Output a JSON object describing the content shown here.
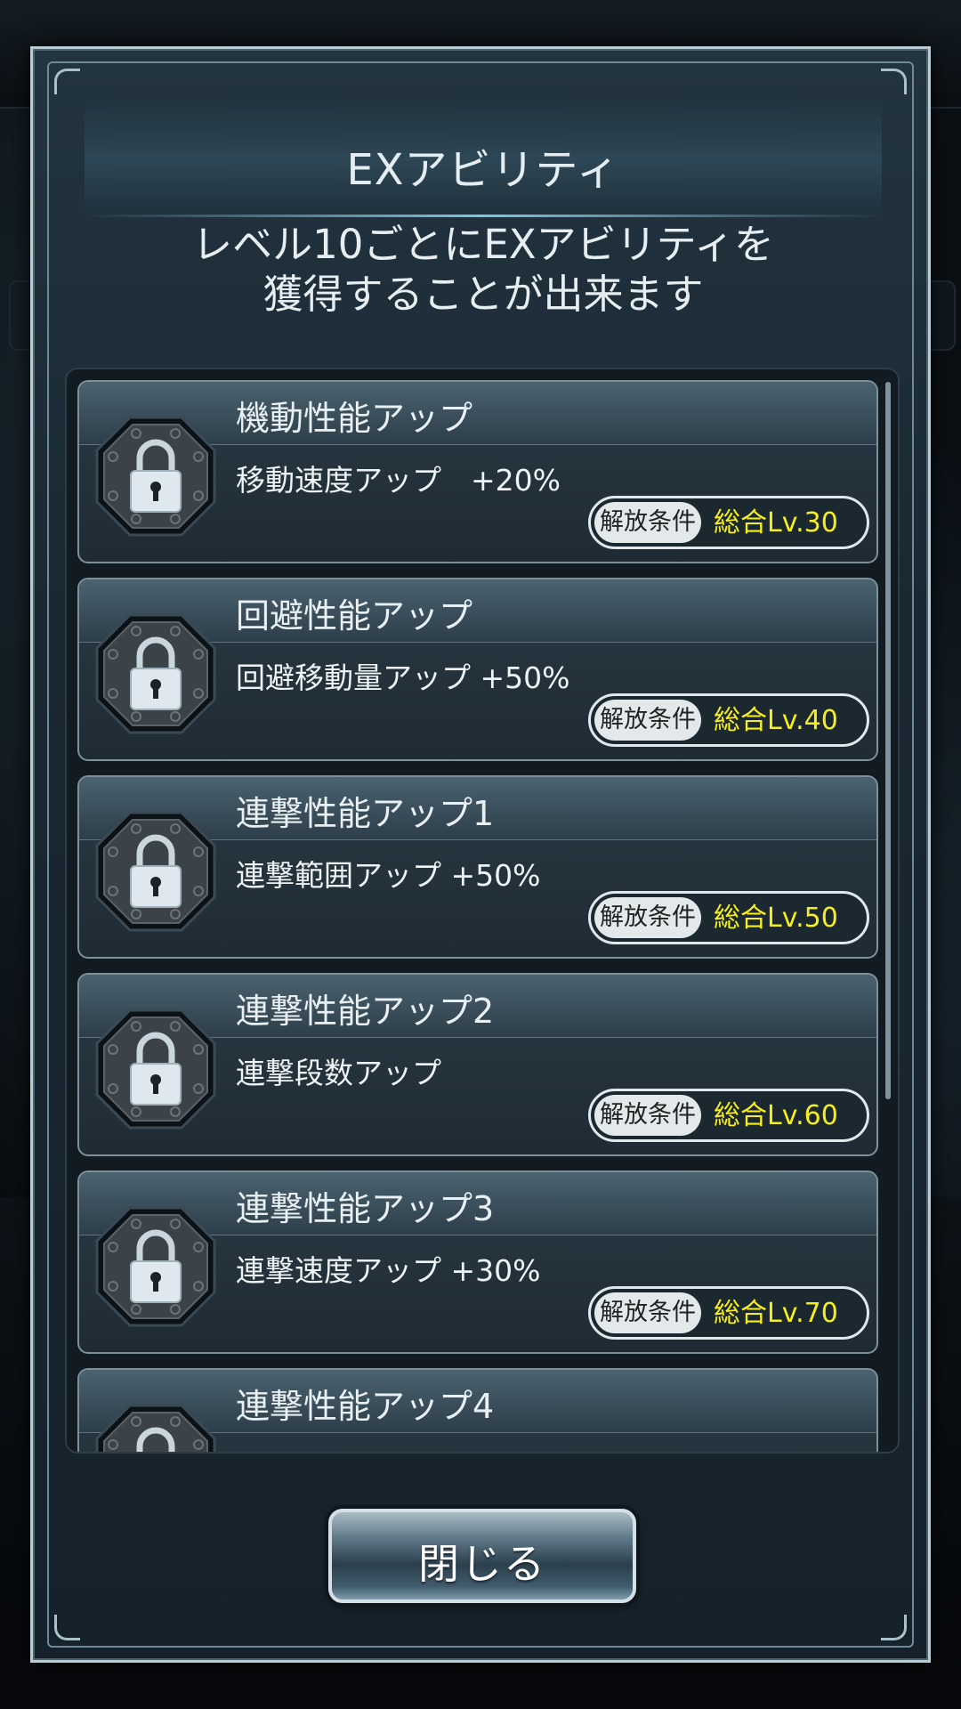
{
  "dialog": {
    "title": "EXアビリティ",
    "subtitle_line1": "レベル10ごとにEXアビリティを",
    "subtitle_line2": "獲得することが出来ます",
    "close_label": "閉じる"
  },
  "abilities": [
    {
      "name": "機動性能アップ",
      "desc": "移動速度アップ　+20%",
      "req_label": "解放条件",
      "req_value": "総合Lv.30",
      "icon": "lock-icon"
    },
    {
      "name": "回避性能アップ",
      "desc": "回避移動量アップ +50%",
      "req_label": "解放条件",
      "req_value": "総合Lv.40",
      "icon": "lock-icon"
    },
    {
      "name": "連撃性能アップ1",
      "desc": "連撃範囲アップ +50%",
      "req_label": "解放条件",
      "req_value": "総合Lv.50",
      "icon": "lock-icon"
    },
    {
      "name": "連撃性能アップ2",
      "desc": "連撃段数アップ",
      "req_label": "解放条件",
      "req_value": "総合Lv.60",
      "icon": "lock-icon"
    },
    {
      "name": "連撃性能アップ3",
      "desc": "連撃速度アップ +30%",
      "req_label": "解放条件",
      "req_value": "総合Lv.70",
      "icon": "lock-icon"
    },
    {
      "name": "連撃性能アップ4",
      "desc": "",
      "req_label": "",
      "req_value": "",
      "icon": "lock-icon"
    }
  ],
  "colors": {
    "requirement_value": "#f6ee1e",
    "card_border": "#7d919b",
    "accent_line": "#7fc6e0"
  }
}
